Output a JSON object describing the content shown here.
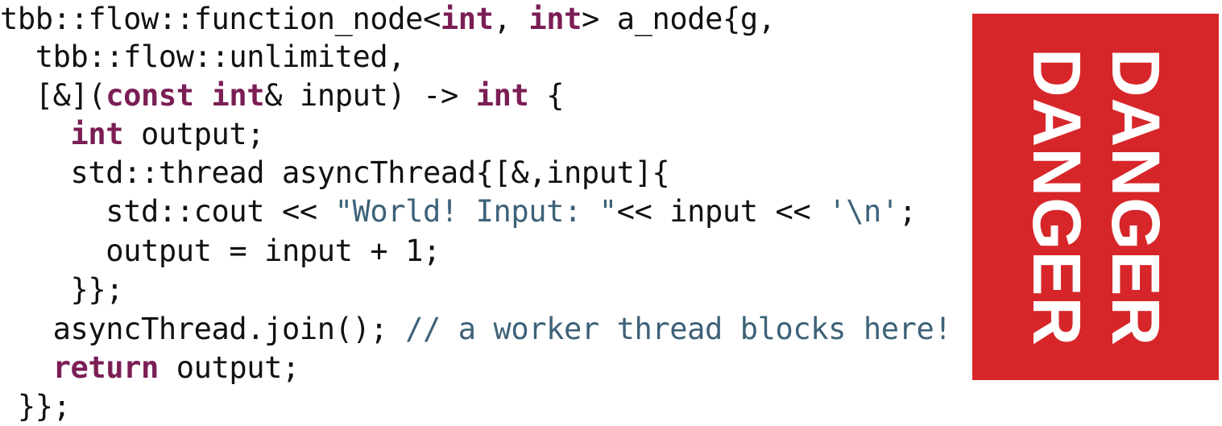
{
  "code": {
    "lines": [
      [
        {
          "t": "tbb::flow::function_node<",
          "k": "plain"
        },
        {
          "t": "int",
          "k": "kw"
        },
        {
          "t": ", ",
          "k": "plain"
        },
        {
          "t": "int",
          "k": "kw"
        },
        {
          "t": "> a_node{g,",
          "k": "plain"
        }
      ],
      [
        {
          "t": "  tbb::flow::unlimited,",
          "k": "plain"
        }
      ],
      [
        {
          "t": "  [&](",
          "k": "plain"
        },
        {
          "t": "const",
          "k": "kw"
        },
        {
          "t": " ",
          "k": "plain"
        },
        {
          "t": "int",
          "k": "kw"
        },
        {
          "t": "& input) -> ",
          "k": "plain"
        },
        {
          "t": "int",
          "k": "kw"
        },
        {
          "t": " {",
          "k": "plain"
        }
      ],
      [
        {
          "t": "    ",
          "k": "plain"
        },
        {
          "t": "int",
          "k": "kw"
        },
        {
          "t": " output;",
          "k": "plain"
        }
      ],
      [
        {
          "t": "    std::thread asyncThread{[&,input]{",
          "k": "plain"
        }
      ],
      [
        {
          "t": "      std::cout << ",
          "k": "plain"
        },
        {
          "t": "\"World! Input: \"",
          "k": "str"
        },
        {
          "t": "<< input << ",
          "k": "plain"
        },
        {
          "t": "'\\n'",
          "k": "str"
        },
        {
          "t": ";",
          "k": "plain"
        }
      ],
      [
        {
          "t": "      output = input + 1;",
          "k": "plain"
        }
      ],
      [
        {
          "t": "    }};",
          "k": "plain"
        }
      ],
      [
        {
          "t": "   asyncThread.join(); ",
          "k": "plain"
        },
        {
          "t": "// a worker thread blocks here!",
          "k": "cmt"
        }
      ],
      [
        {
          "t": "   ",
          "k": "plain"
        },
        {
          "t": "return",
          "k": "kw"
        },
        {
          "t": " output;",
          "k": "plain"
        }
      ],
      [
        {
          "t": " }};",
          "k": "plain"
        }
      ]
    ]
  },
  "danger": {
    "text_1": "DANGER",
    "text_2": "DANGER",
    "color": "#d7262a"
  }
}
